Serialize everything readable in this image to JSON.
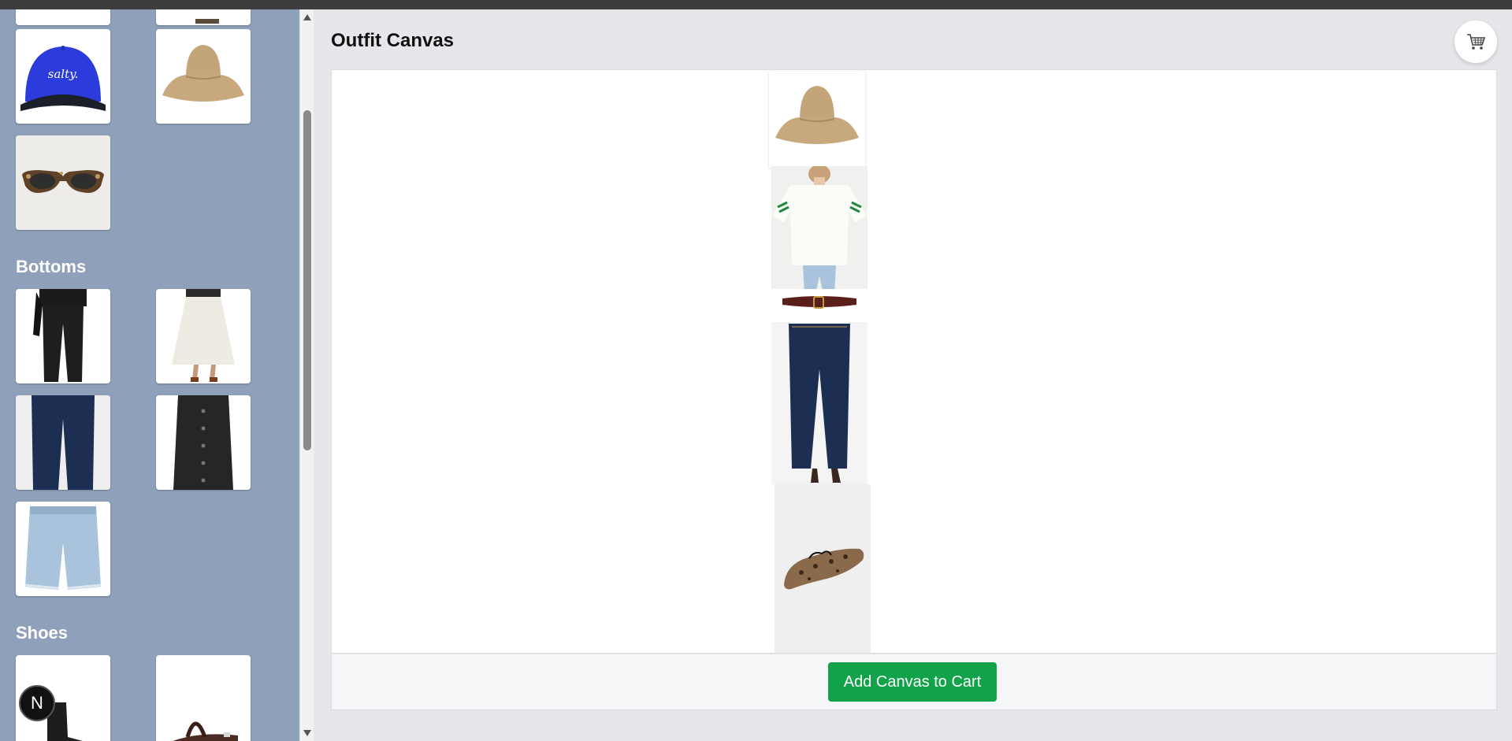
{
  "sidebar": {
    "sections": {
      "bottoms": {
        "title": "Bottoms"
      },
      "shoes": {
        "title": "Shoes"
      }
    },
    "items": {
      "cap": {
        "text": "salty."
      }
    }
  },
  "main": {
    "title": "Outfit Canvas",
    "cart_icon": "cart-icon",
    "add_button": "Add Canvas to Cart"
  },
  "badge": {
    "letter": "N"
  }
}
